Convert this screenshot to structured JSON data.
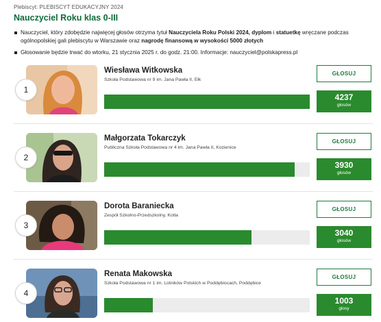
{
  "header": {
    "kicker": "Plebiscyt: PLEBISCYT EDUKACYJNY 2024",
    "title": "Nauczyciel Roku klas 0-III",
    "rule1": {
      "a": "Nauczyciel, który zdobędzie najwięcej głosów otrzyma tytuł ",
      "b": "Nauczyciela Roku Polski 2024, dyplom",
      "c": " i ",
      "d": "statuetkę",
      "e": " wręczane podczas ogólnopolskiej gali plebiscytu w Warszawie oraz ",
      "f": "nagrodę finansową w wysokości 5000 złotych"
    },
    "rule2": "Głosowanie będzie trwać do wtorku, 21 stycznia 2025 r. do godz. 21:00. Informacje: nauczyciel@polskapress.pl"
  },
  "vote_label": "GŁOSUJ",
  "candidates": [
    {
      "rank": "1",
      "name": "Wiesława Witkowska",
      "school": "Szkoła Podstawowa nr 9 im. Jana Pawła II, Ełk",
      "votes": "4237",
      "votes_label": "głosów",
      "share": 1.0
    },
    {
      "rank": "2",
      "name": "Małgorzata Tokarczyk",
      "school": "Publiczna Szkoła Podstawowa nr 4 im. Jana Pawła II, Kozienice",
      "votes": "3930",
      "votes_label": "głosów",
      "share": 0.9276
    },
    {
      "rank": "3",
      "name": "Dorota Baraniecka",
      "school": "Zespół Szkolno-Przedszkolny, Kotla",
      "votes": "3040",
      "votes_label": "głosów",
      "share": 0.7175
    },
    {
      "rank": "4",
      "name": "Renata Makowska",
      "school": "Szkoła Podstawowa nr 1 im. Lotników Polskich w Poddębiocach, Poddębice",
      "votes": "1003",
      "votes_label": "głosy",
      "share": 0.2367
    }
  ],
  "colors": {
    "accent": "#0e6b3a",
    "bar": "#2a8a2e",
    "track": "#ececec"
  }
}
